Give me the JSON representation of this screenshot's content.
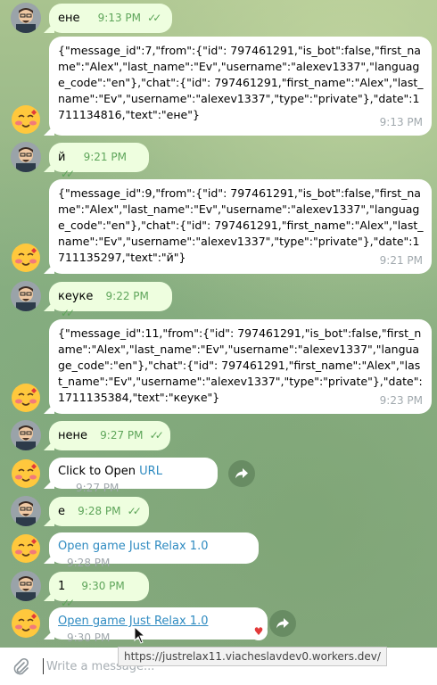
{
  "messages": [
    {
      "from": "user",
      "avatar": "man",
      "text": "ене",
      "time": "9:13 PM",
      "read": "✓✓"
    },
    {
      "from": "bot",
      "avatar": "emoji",
      "text": "{\"message_id\":7,\"from\":{\"id\": 797461291,\"is_bot\":false,\"first_name\":\"Alex\",\"last_name\":\"Ev\",\"username\":\"alexev1337\",\"language_code\":\"en\"},\"chat\":{\"id\": 797461291,\"first_name\":\"Alex\",\"last_name\":\"Ev\",\"username\":\"alexev1337\",\"type\":\"private\"},\"date\":1711134816,\"text\":\"ене\"}",
      "time": "9:13 PM"
    },
    {
      "from": "user",
      "avatar": "man",
      "text": "й",
      "time": "9:21 PM",
      "read": "✓✓"
    },
    {
      "from": "bot",
      "avatar": "emoji",
      "text": "{\"message_id\":9,\"from\":{\"id\": 797461291,\"is_bot\":false,\"first_name\":\"Alex\",\"last_name\":\"Ev\",\"username\":\"alexev1337\",\"language_code\":\"en\"},\"chat\":{\"id\": 797461291,\"first_name\":\"Alex\",\"last_name\":\"Ev\",\"username\":\"alexev1337\",\"type\":\"private\"},\"date\":1711135297,\"text\":\"й\"}",
      "time": "9:21 PM"
    },
    {
      "from": "user",
      "avatar": "man",
      "text": "кеуке",
      "time": "9:22 PM",
      "read": "✓✓"
    },
    {
      "from": "bot",
      "avatar": "emoji",
      "text": "{\"message_id\":11,\"from\":{\"id\": 797461291,\"is_bot\":false,\"first_name\":\"Alex\",\"last_name\":\"Ev\",\"username\":\"alexev1337\",\"language_code\":\"en\"},\"chat\":{\"id\": 797461291,\"first_name\":\"Alex\",\"last_name\":\"Ev\",\"username\":\"alexev1337\",\"type\":\"private\"},\"date\":1711135384,\"text\":\"кеуке\"}",
      "time": "9:23 PM"
    },
    {
      "from": "user",
      "avatar": "man",
      "text": "нене",
      "time": "9:27 PM",
      "read": "✓✓"
    },
    {
      "from": "bot",
      "avatar": "emoji",
      "text_prefix": "Click to Open ",
      "link": "URL",
      "time": "9:27 PM"
    },
    {
      "from": "user",
      "avatar": "man",
      "text": "е",
      "time": "9:28 PM",
      "read": "✓✓"
    },
    {
      "from": "bot",
      "avatar": "emoji",
      "link": "Open game Just Relax 1.0",
      "time": "9:28 PM"
    },
    {
      "from": "user",
      "avatar": "man",
      "text": "1",
      "time": "9:30 PM",
      "read": "✓✓"
    },
    {
      "from": "bot",
      "avatar": "emoji",
      "link": "Open game Just Relax 1.0",
      "time": "9:30 PM",
      "reaction": "♥"
    }
  ],
  "tooltip": "https://justrelax11.viacheslavdev0.workers.dev/",
  "composer": {
    "placeholder": "Write a message..."
  },
  "colors": {
    "outgoing": "#eefedf",
    "incoming": "#ffffff",
    "link": "#2f8bc1",
    "check": "#5ea55a",
    "time": "#a0a8ad"
  }
}
